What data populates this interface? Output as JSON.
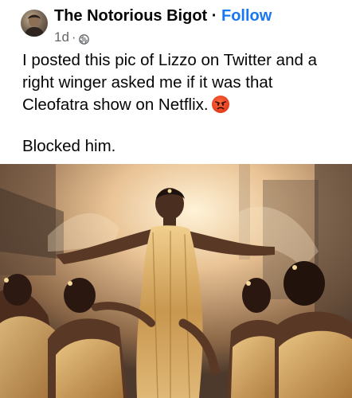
{
  "post": {
    "author": "The Notorious Bigot",
    "separator": "·",
    "follow_label": "Follow",
    "timestamp": "1d",
    "meta_separator": "·",
    "audience_icon": "globe-icon",
    "text_lines": [
      "I posted this pic of Lizzo on Twitter and a right winger asked me if it was that Cleofatra show on Netflix."
    ],
    "emoji": "angry-face-emoji",
    "text_second": "Blocked him."
  },
  "colors": {
    "link": "#1877f2",
    "text": "#050505",
    "muted": "#65676b"
  }
}
